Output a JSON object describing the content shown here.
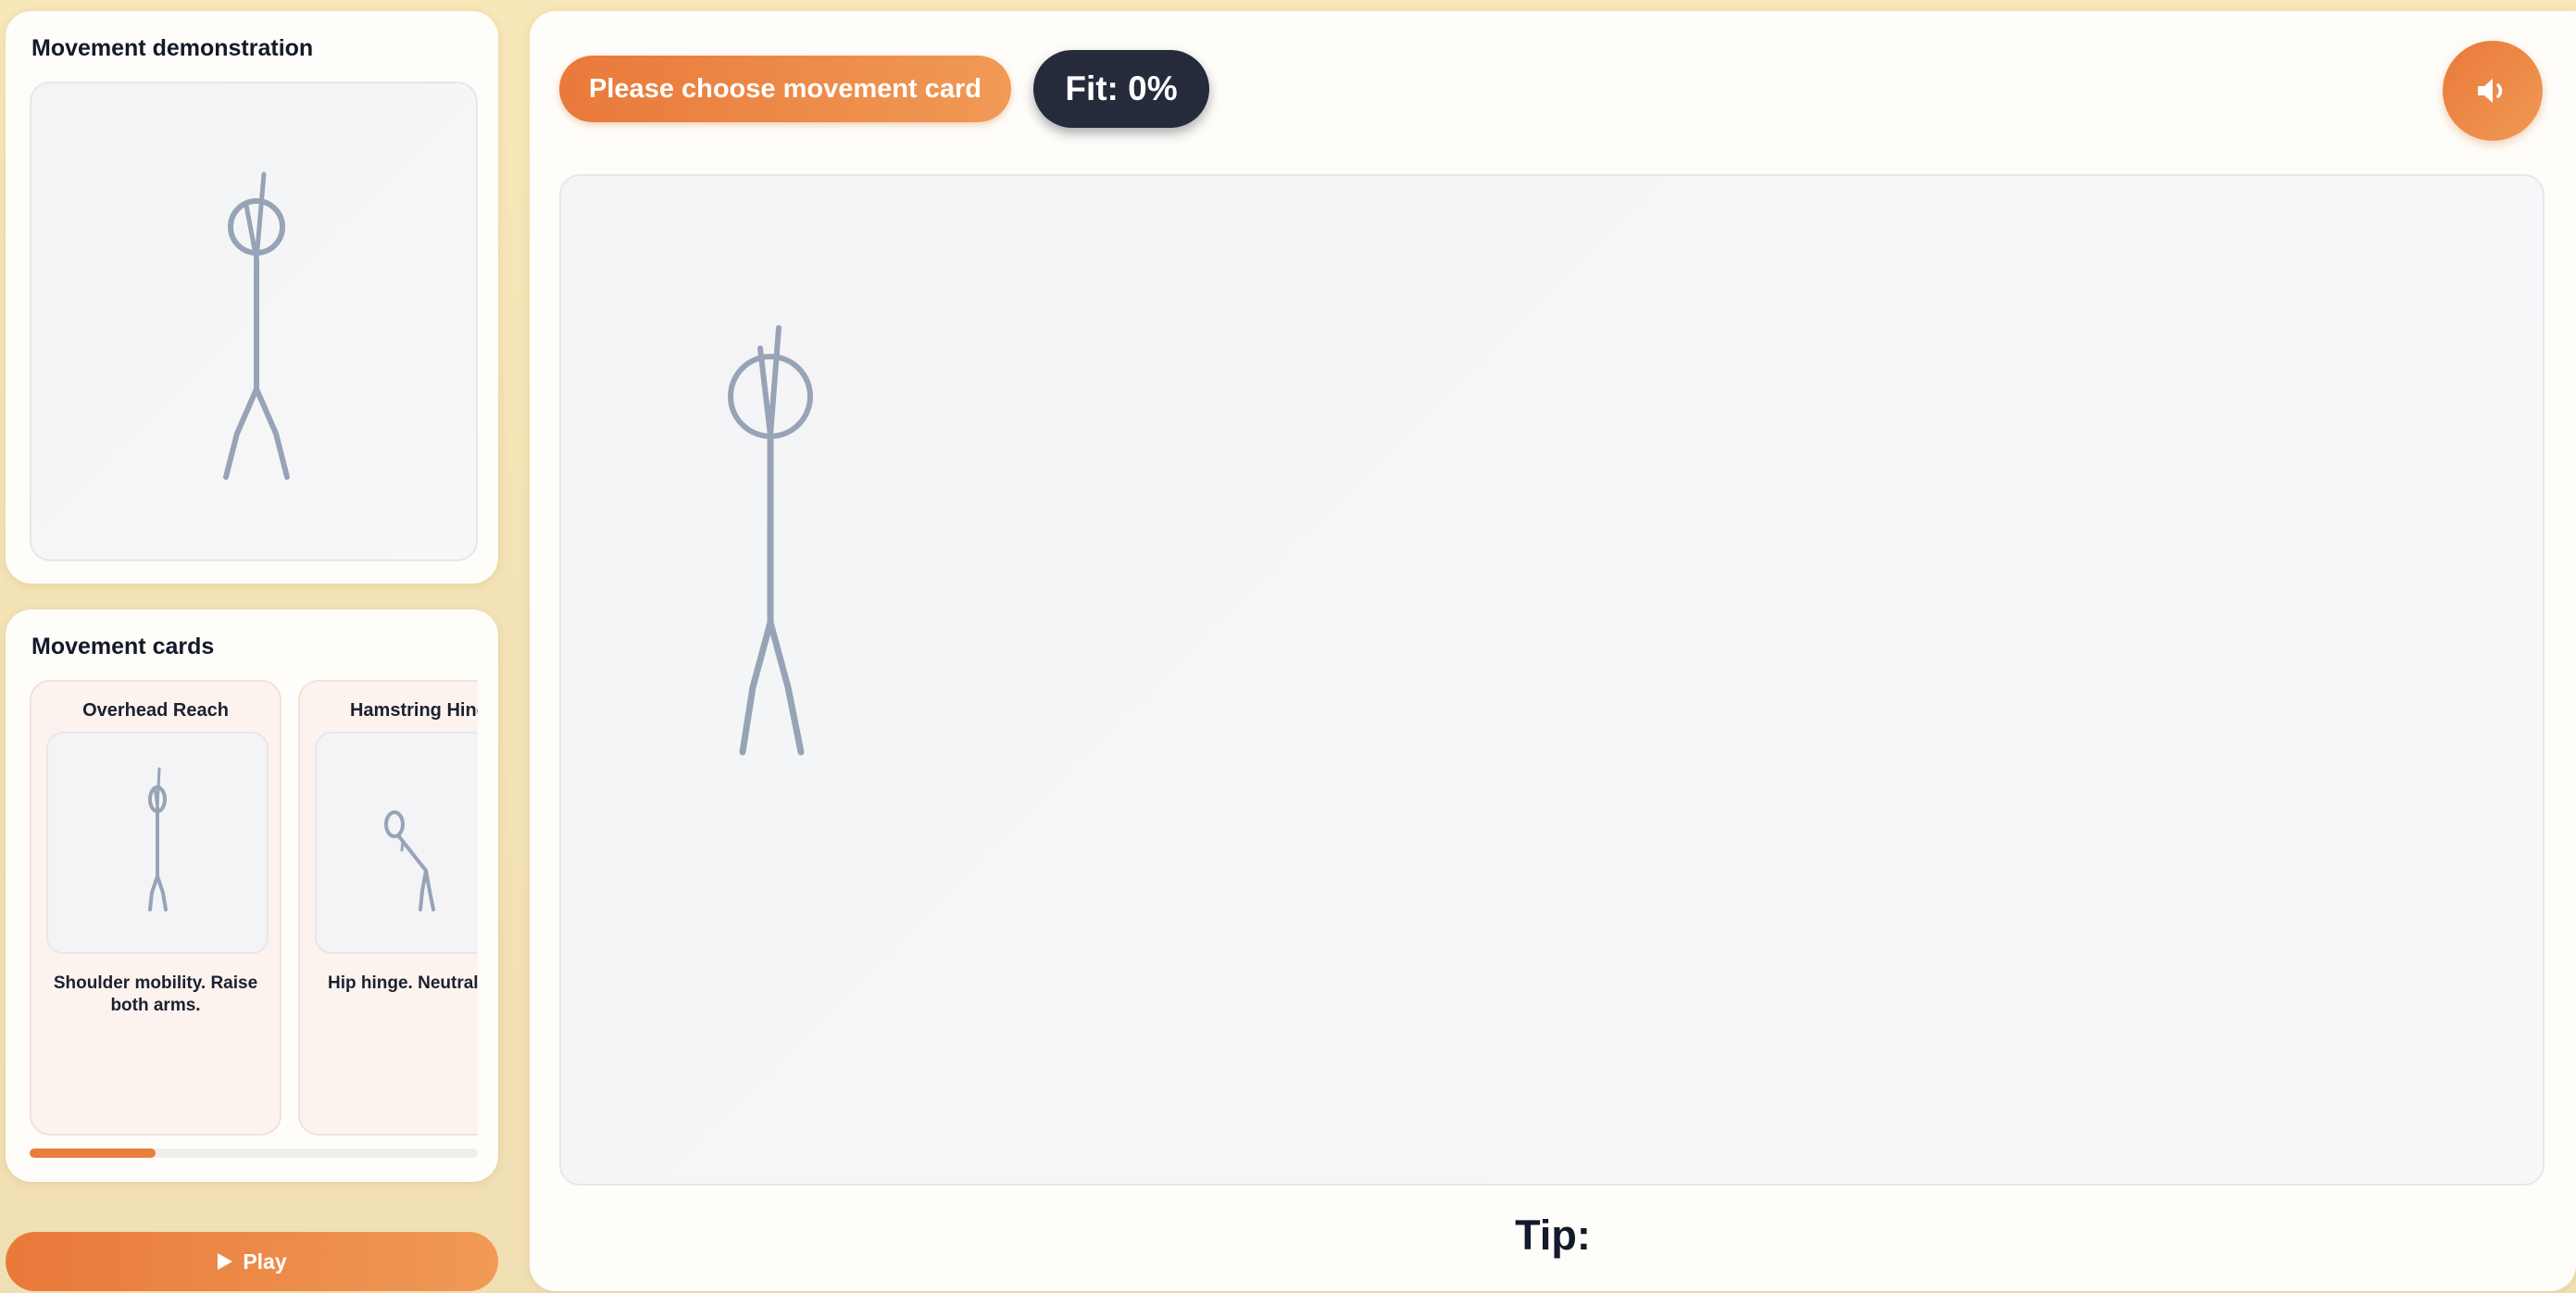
{
  "demo": {
    "title": "Movement demonstration"
  },
  "cards": {
    "title": "Movement cards",
    "items": [
      {
        "title": "Overhead Reach",
        "description": "Shoulder mobility. Raise both arms."
      },
      {
        "title": "Hamstring Hinge",
        "description": "Hip hinge. Neutral spine."
      }
    ],
    "scroll_progress": 0.28
  },
  "play": {
    "icon": "play-icon",
    "label": "Play"
  },
  "main": {
    "status_label": "Please choose movement card",
    "fit_label": "Fit: 0%",
    "sound_icon": "speaker-icon",
    "tip_label": "Tip:"
  },
  "colors": {
    "accent": "#e9793a",
    "badge": "#252b3b",
    "figure": "#97a3b6"
  }
}
